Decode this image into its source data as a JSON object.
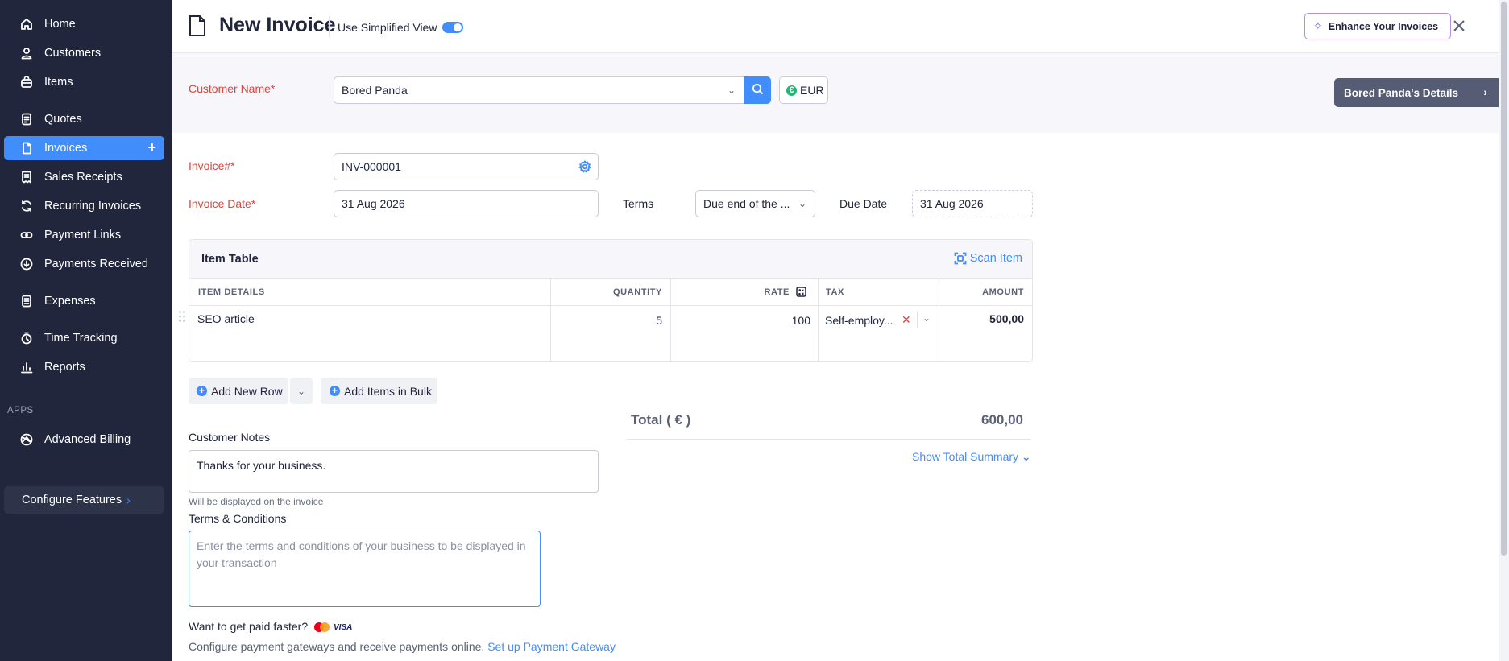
{
  "sidebar": {
    "items": [
      {
        "label": "Home",
        "icon": "home-icon"
      },
      {
        "label": "Customers",
        "icon": "user-icon"
      },
      {
        "label": "Items",
        "icon": "bag-icon"
      },
      {
        "label": "Quotes",
        "icon": "quote-doc-icon"
      },
      {
        "label": "Invoices",
        "icon": "invoice-doc-icon",
        "active": true
      },
      {
        "label": "Sales Receipts",
        "icon": "receipt-icon"
      },
      {
        "label": "Recurring Invoices",
        "icon": "recurring-icon"
      },
      {
        "label": "Payment Links",
        "icon": "link-icon"
      },
      {
        "label": "Payments Received",
        "icon": "payment-received-icon"
      },
      {
        "label": "Expenses",
        "icon": "expense-icon"
      },
      {
        "label": "Time Tracking",
        "icon": "stopwatch-icon"
      },
      {
        "label": "Reports",
        "icon": "bar-chart-icon"
      }
    ],
    "apps_heading": "APPS",
    "apps": [
      {
        "label": "Advanced Billing",
        "icon": "billing-icon"
      }
    ],
    "configure_label": "Configure Features"
  },
  "header": {
    "title": "New Invoice",
    "simplified_view_label": "Use Simplified View",
    "simplified_view_on": true,
    "enhance_label": "Enhance Your Invoices"
  },
  "customer": {
    "label": "Customer Name*",
    "value": "Bored Panda",
    "currency": "EUR",
    "details_label": "Bored Panda's Details"
  },
  "invoice": {
    "number_label": "Invoice#*",
    "number_value": "INV-000001",
    "date_label": "Invoice Date*",
    "date_value": "31 Aug 2026",
    "terms_label": "Terms",
    "terms_value": "Due end of the ...",
    "due_label": "Due Date",
    "due_value": "31 Aug 2026"
  },
  "item_table": {
    "title": "Item Table",
    "scan_label": "Scan Item",
    "columns": {
      "details": "ITEM DETAILS",
      "quantity": "QUANTITY",
      "rate": "RATE",
      "tax": "TAX",
      "amount": "AMOUNT"
    },
    "rows": [
      {
        "details": "SEO article",
        "quantity": "5",
        "rate": "100",
        "tax": "Self-employ...",
        "amount": "500,00"
      }
    ]
  },
  "actions": {
    "add_row": "Add New Row",
    "add_bulk": "Add Items in Bulk"
  },
  "totals": {
    "label": "Total ( € )",
    "value": "600,00",
    "show_summary": "Show Total Summary"
  },
  "notes": {
    "label": "Customer Notes",
    "value": "Thanks for your business.",
    "hint": "Will be displayed on the invoice"
  },
  "terms_conditions": {
    "label": "Terms & Conditions",
    "placeholder": "Enter the terms and conditions of your business to be displayed in your transaction"
  },
  "payment": {
    "question": "Want to get paid faster?",
    "visa_text": "VISA",
    "description": "Configure payment gateways and receive payments online.",
    "link": "Set up Payment Gateway"
  },
  "colors": {
    "sidebar_bg": "#21263c",
    "accent": "#408dfb",
    "required": "#d6473c"
  }
}
